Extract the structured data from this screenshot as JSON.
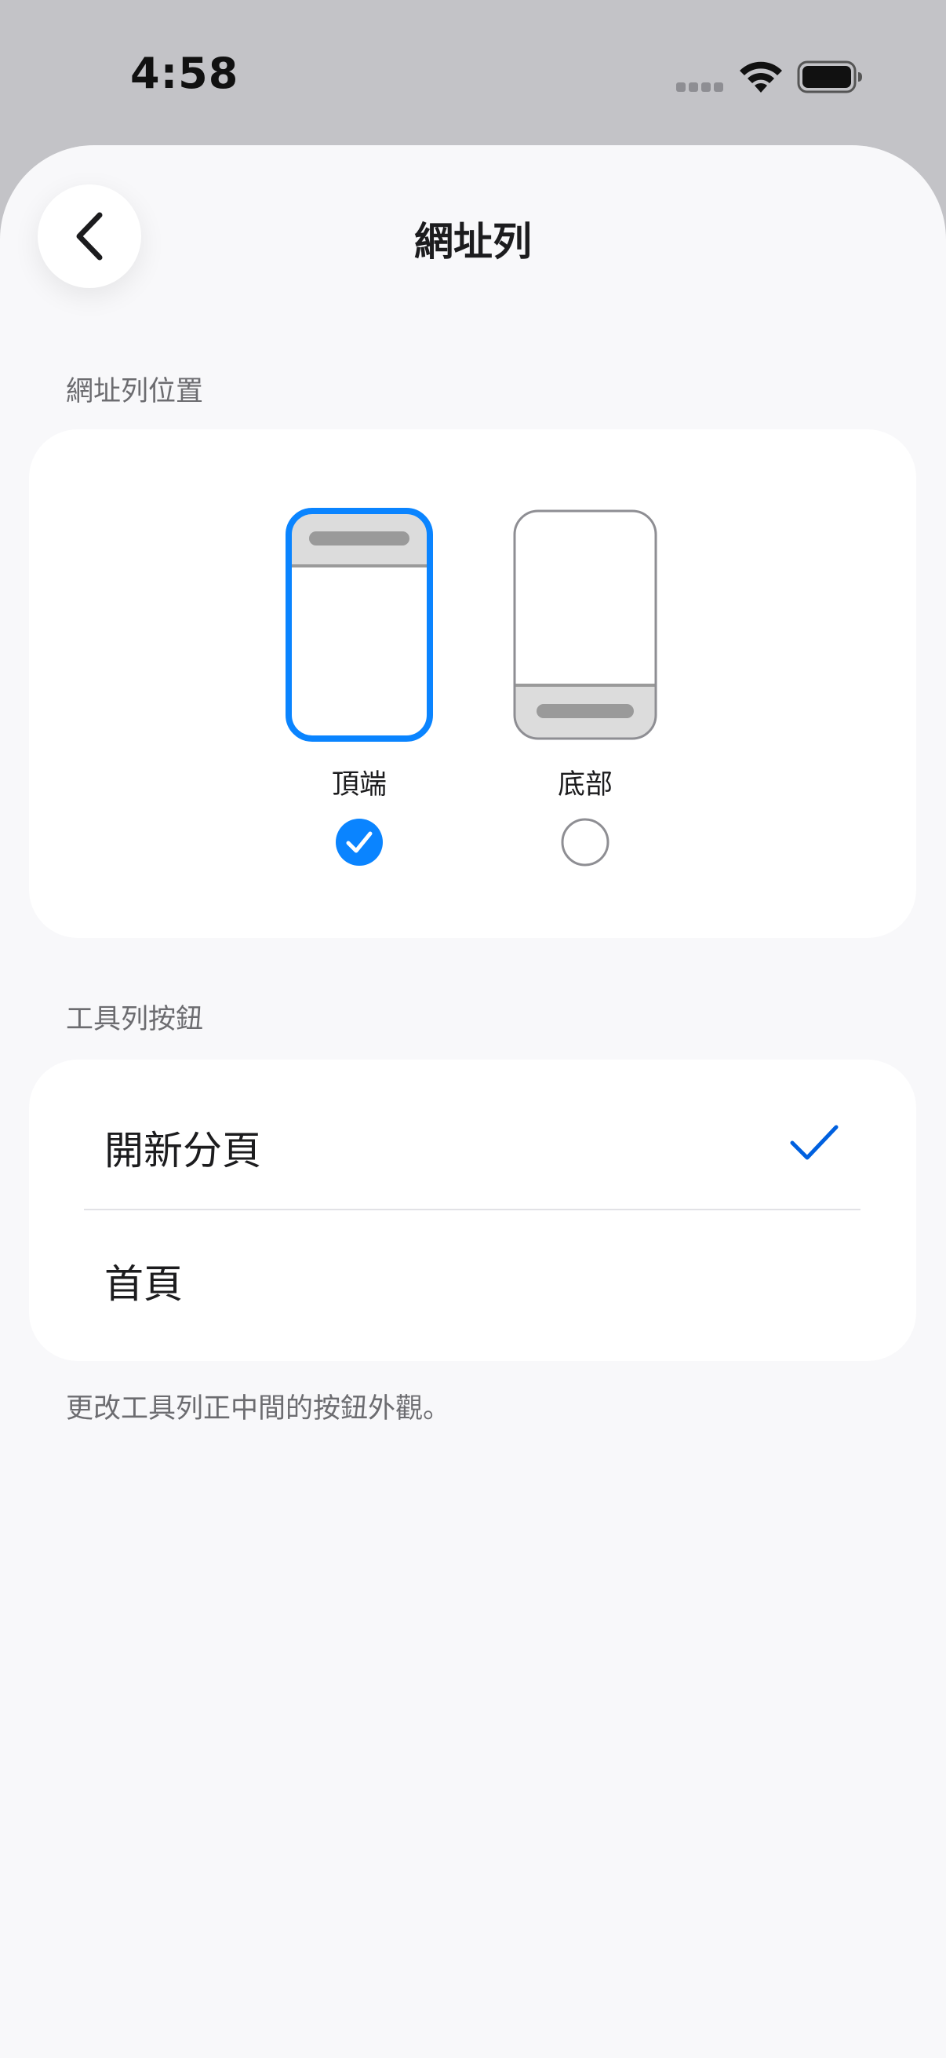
{
  "status_bar": {
    "time": "4:58"
  },
  "header": {
    "title": "網址列",
    "back_icon": "chevron-left-icon"
  },
  "address_bar_position": {
    "section_label": "網址列位置",
    "options": [
      {
        "label": "頂端",
        "selected": true
      },
      {
        "label": "底部",
        "selected": false
      }
    ]
  },
  "toolbar_button": {
    "section_label": "工具列按鈕",
    "items": [
      {
        "label": "開新分頁",
        "selected": true
      },
      {
        "label": "首頁",
        "selected": false
      }
    ],
    "footnote": "更改工具列正中間的按鈕外觀。"
  },
  "colors": {
    "accent": "#0a84ff",
    "check": "#0060df",
    "background": "#f8f8fa",
    "card": "#ffffff"
  }
}
